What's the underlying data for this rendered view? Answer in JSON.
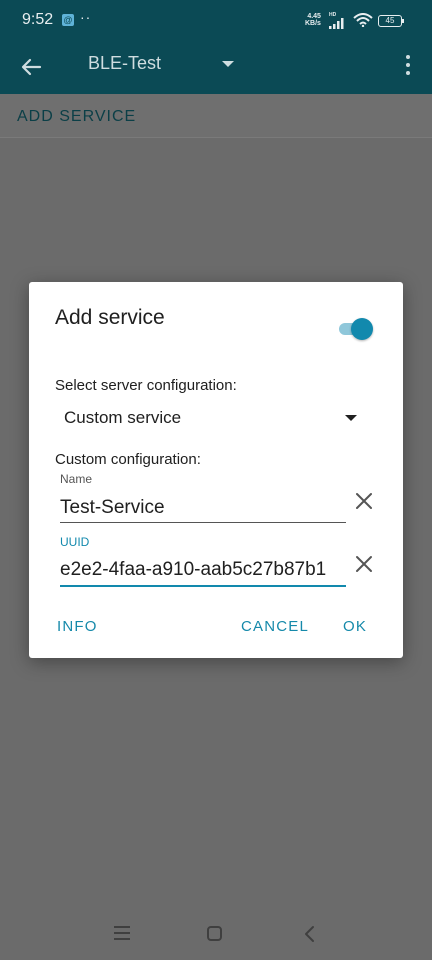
{
  "status_bar": {
    "time": "9:52",
    "app_icon_glyph": "@",
    "notification_dots": "··",
    "net_speed_value": "4.45",
    "net_speed_unit": "KB/s",
    "hd_label": "HD",
    "battery": "45"
  },
  "app_bar": {
    "title": "BLE-Test",
    "back_icon": "arrow-left-icon",
    "overflow_icon": "more-vert-icon"
  },
  "sub_bar": {
    "add_service_label": "ADD SERVICE"
  },
  "dialog": {
    "title": "Add service",
    "toggle_on": true,
    "select_label": "Select server configuration:",
    "select_value": "Custom service",
    "custom_label": "Custom configuration:",
    "name_caption": "Name",
    "name_value": "Test-Service",
    "uuid_caption": "UUID",
    "uuid_value": "e2e2-4faa-a910-aab5c27b87b1",
    "buttons": {
      "info": "INFO",
      "cancel": "CANCEL",
      "ok": "OK"
    }
  },
  "colors": {
    "app_bar": "#0b4a55",
    "accent": "#1289ad",
    "scrim": "#6b6b6b"
  }
}
